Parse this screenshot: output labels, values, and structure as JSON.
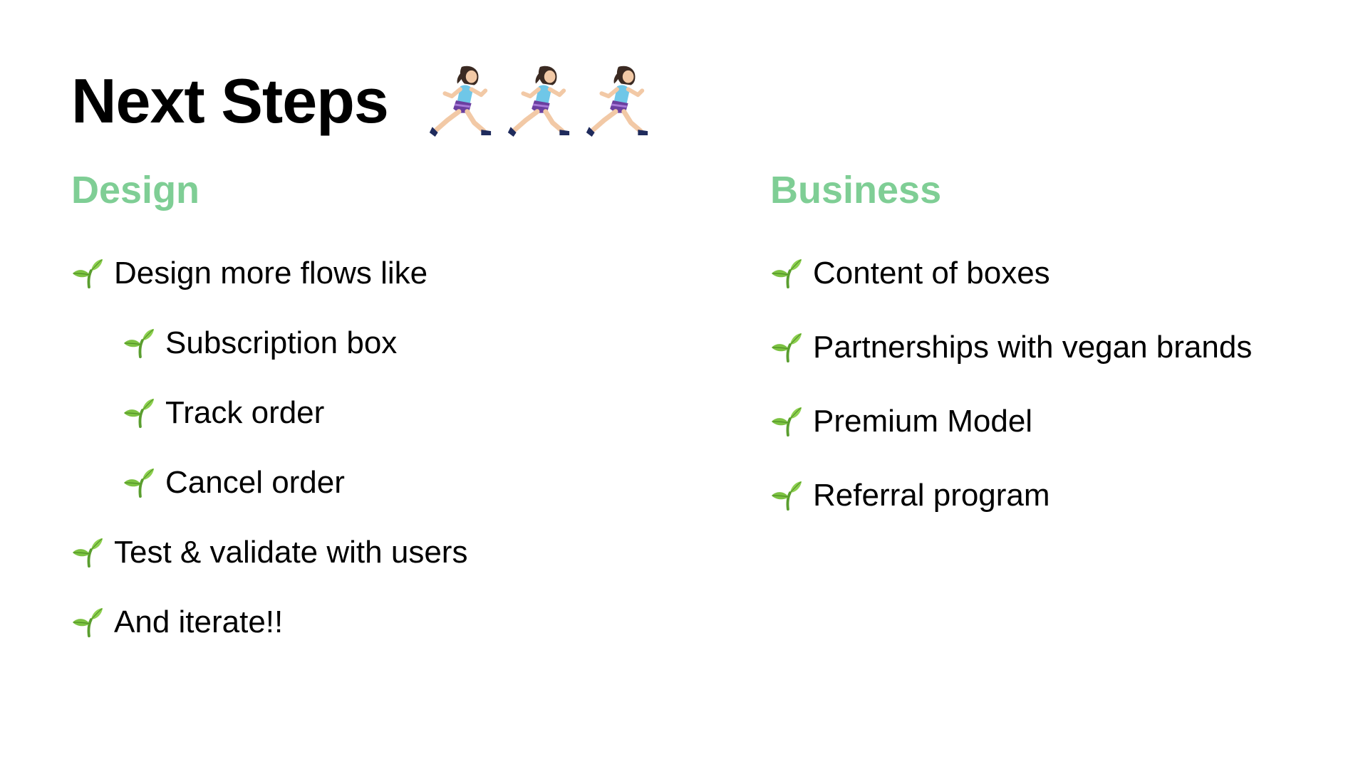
{
  "slide": {
    "title": "Next Steps",
    "title_icons": [
      "woman-running-icon",
      "woman-running-icon",
      "woman-running-icon"
    ],
    "colors": {
      "heading_green": "#7fce95",
      "text": "#000000",
      "background": "#ffffff"
    }
  },
  "design": {
    "heading": "Design",
    "items": [
      {
        "text": "Design more flows like",
        "level": 1,
        "icon": "sprout-icon"
      },
      {
        "text": "Subscription box",
        "level": 2,
        "icon": "sprout-icon"
      },
      {
        "text": "Track order",
        "level": 2,
        "icon": "sprout-icon"
      },
      {
        "text": "Cancel order",
        "level": 2,
        "icon": "sprout-icon"
      },
      {
        "text": "Test & validate with users",
        "level": 1,
        "icon": "sprout-icon"
      },
      {
        "text": "And iterate!!",
        "level": 1,
        "icon": "sprout-icon"
      }
    ]
  },
  "business": {
    "heading": "Business",
    "items": [
      {
        "text": "Content of boxes",
        "level": 1,
        "icon": "sprout-icon"
      },
      {
        "text": "Partnerships with vegan brands",
        "level": 1,
        "icon": "sprout-icon"
      },
      {
        "text": "Premium Model",
        "level": 1,
        "icon": "sprout-icon"
      },
      {
        "text": "Referral program",
        "level": 1,
        "icon": "sprout-icon"
      }
    ]
  }
}
